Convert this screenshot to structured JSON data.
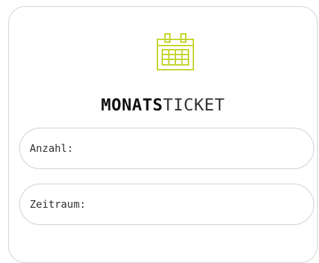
{
  "card": {
    "title_bold": "MONATS",
    "title_light": "TICKET",
    "icon": "calendar-icon"
  },
  "fields": {
    "quantity_label": "Anzahl:",
    "period_label": "Zeitraum:"
  },
  "colors": {
    "accent": "#c3d42b",
    "border": "#d2d2d2",
    "text": "#111111"
  }
}
